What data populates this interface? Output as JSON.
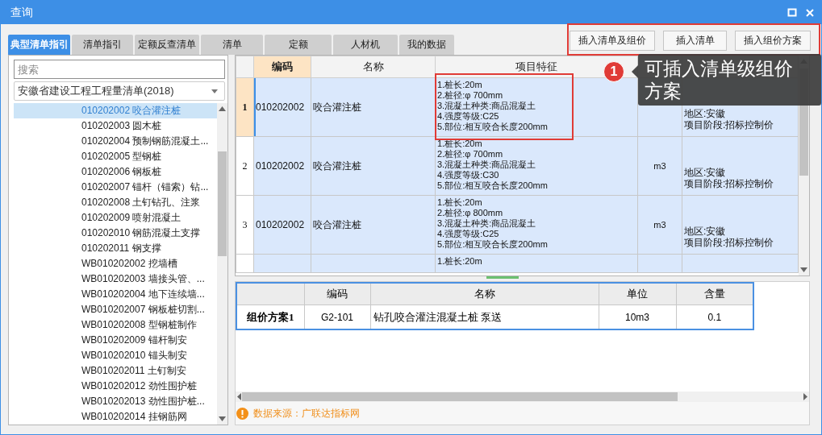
{
  "window": {
    "title": "查询"
  },
  "tabs": [
    {
      "label": "典型清单指引",
      "selected": true
    },
    {
      "label": "清单指引",
      "selected": false
    },
    {
      "label": "定额反查清单",
      "selected": false
    },
    {
      "label": "清单",
      "selected": false
    },
    {
      "label": "定额",
      "selected": false
    },
    {
      "label": "人材机",
      "selected": false
    },
    {
      "label": "我的数据",
      "selected": false
    }
  ],
  "toolbar": {
    "buttons": [
      "插入清单及组价",
      "插入清单",
      "插入组价方案"
    ]
  },
  "sidebar": {
    "search": {
      "placeholder": "搜索"
    },
    "library": {
      "value": "安徽省建设工程工程量清单(2018)"
    },
    "items": [
      {
        "label": "010202002 咬合灌注桩",
        "selected": true
      },
      {
        "label": "010202003 圆木桩",
        "selected": false
      },
      {
        "label": "010202004 预制钢筋混凝土...",
        "selected": false
      },
      {
        "label": "010202005 型钢桩",
        "selected": false
      },
      {
        "label": "010202006 钢板桩",
        "selected": false
      },
      {
        "label": "010202007 锚杆（锚索）钻...",
        "selected": false
      },
      {
        "label": "010202008 土钉钻孔、注浆",
        "selected": false
      },
      {
        "label": "010202009 喷射混凝土",
        "selected": false
      },
      {
        "label": "010202010 钢筋混凝土支撑",
        "selected": false
      },
      {
        "label": "010202011 钢支撑",
        "selected": false
      },
      {
        "label": "WB010202002 挖墙槽",
        "selected": false
      },
      {
        "label": "WB010202003 墙接头管、...",
        "selected": false
      },
      {
        "label": "WB010202004 地下连续墙...",
        "selected": false
      },
      {
        "label": "WB010202007 钢板桩切割...",
        "selected": false
      },
      {
        "label": "WB010202008 型钢桩制作",
        "selected": false
      },
      {
        "label": "WB010202009 锚杆制安",
        "selected": false
      },
      {
        "label": "WB010202010 锚头制安",
        "selected": false
      },
      {
        "label": "WB010202011 土钉制安",
        "selected": false
      },
      {
        "label": "WB010202012 劲性围护桩",
        "selected": false
      },
      {
        "label": "WB010202013 劲性围护桩...",
        "selected": false
      },
      {
        "label": "WB010202014 挂钢筋网",
        "selected": false
      }
    ]
  },
  "table": {
    "columns": [
      {
        "label": "编码",
        "selected": true
      },
      {
        "label": "名称",
        "selected": false
      },
      {
        "label": "项目特征",
        "selected": false
      }
    ],
    "rows": [
      {
        "number": "1",
        "selected": true,
        "code": "010202002",
        "name": "咬合灌注桩",
        "features": [
          "1.桩长:20m",
          "2.桩径:φ 700mm",
          "3.混凝土种类:商品混凝土",
          "4.强度等级:C25",
          "5.部位:相互咬合长度200mm"
        ],
        "remarks": [
          "地区:安徽",
          "项目阶段:招标控制价"
        ]
      },
      {
        "number": "2",
        "selected": false,
        "code": "010202002",
        "name": "咬合灌注桩",
        "features": [
          "1.桩长:20m",
          "2.桩径:φ 700mm",
          "3.混凝土种类:商品混凝土",
          "4.强度等级:C30",
          "5.部位:相互咬合长度200mm"
        ],
        "unit": "m3",
        "remarks": [
          "地区:安徽",
          "项目阶段:招标控制价"
        ]
      },
      {
        "number": "3",
        "selected": false,
        "code": "010202002",
        "name": "咬合灌注桩",
        "features": [
          "1.桩长:20m",
          "2.桩径:φ 800mm",
          "3.混凝土种类:商品混凝土",
          "4.强度等级:C25",
          "5.部位:相互咬合长度200mm"
        ],
        "unit": "m3",
        "remarks": [
          "地区:安徽",
          "项目阶段:招标控制价"
        ]
      },
      {
        "selected": false,
        "features": [
          "1.桩长:20m"
        ]
      }
    ]
  },
  "plan_table": {
    "columns": [
      "编码",
      "名称",
      "单位",
      "含量"
    ],
    "rows": [
      {
        "label": "组价方案1",
        "code": "G2-101",
        "name": "钻孔咬合灌注混凝土桩 泵送",
        "unit": "10m3",
        "amount": "0.1"
      }
    ]
  },
  "source_note": "数据来源：广联达指标网",
  "callout": {
    "number": "1",
    "text": "可插入清单级组价方案"
  }
}
